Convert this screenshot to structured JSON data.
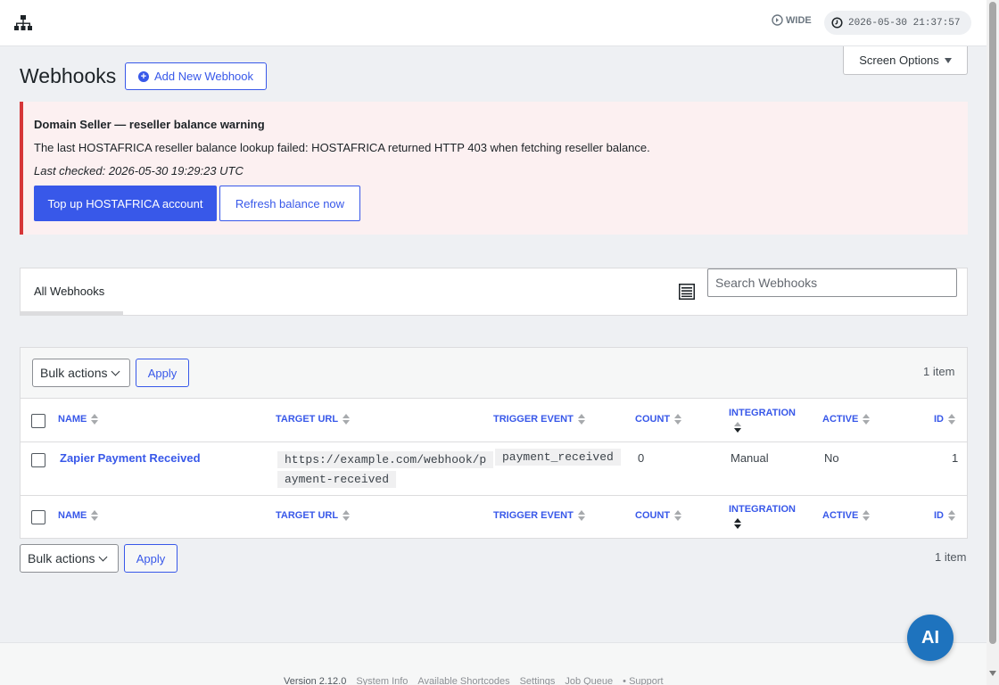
{
  "header": {
    "wide_label": "WIDE",
    "datetime": "2026-05-30 21:37:57"
  },
  "screen_options": {
    "label": "Screen Options"
  },
  "page": {
    "title": "Webhooks",
    "add_button": "Add New Webhook"
  },
  "notice": {
    "title": "Domain Seller — reseller balance warning",
    "message": "The last HOSTAFRICA reseller balance lookup failed: HOSTAFRICA returned HTTP 403 when fetching reseller balance.",
    "checked": "Last checked: 2026-05-30 19:29:23 UTC",
    "topup_button": "Top up HOSTAFRICA account",
    "refresh_button": "Refresh balance now"
  },
  "tabs": {
    "all_label": "All Webhooks",
    "search_placeholder": "Search Webhooks"
  },
  "table": {
    "bulk_label": "Bulk actions",
    "apply_label": "Apply",
    "items_count": "1 item",
    "columns": {
      "name": "NAME",
      "target_url": "TARGET URL",
      "trigger_event": "TRIGGER EVENT",
      "count": "COUNT",
      "integration": "INTEGRATION",
      "active": "ACTIVE",
      "id": "ID"
    },
    "rows": [
      {
        "name": "Zapier Payment Received",
        "url_line1": "https://example.com/webhook/p",
        "url_line2": "ayment-received",
        "trigger": "payment_received",
        "count": "0",
        "integration": "Manual",
        "active": "No",
        "id": "1"
      }
    ]
  },
  "footer": {
    "version": "Version 2.12.0",
    "links": [
      "System Info",
      "Available Shortcodes",
      "Settings",
      "Job Queue",
      "• Support"
    ]
  },
  "fab": {
    "label": "AI"
  },
  "colors": {
    "accent": "#3858e9",
    "error": "#d63638",
    "fab": "#1e73be"
  }
}
